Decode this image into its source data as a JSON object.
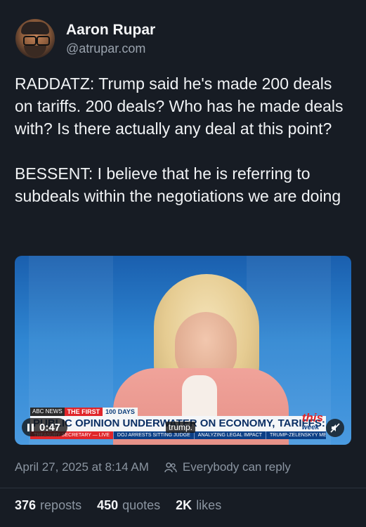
{
  "author": {
    "name": "Aaron Rupar",
    "handle": "@atrupar.com"
  },
  "post": {
    "text": "RADDATZ: Trump said he's made 200 deals on tariffs. 200 deals? Who has he made deals with? Is there actually any deal at this point?\n\nBESSENT: I believe that he is referring to subdeals within the negotiations we are doing"
  },
  "video": {
    "banner_brand": "ABC NEWS",
    "banner_tag": "THE FIRST",
    "banner_tag2": "100 DAYS",
    "headline": "PUBLIC OPINION UNDERWATER ON ECONOMY, TARIFFS: ABC POLL",
    "ticker": [
      "TREASURY SECRETARY — LIVE",
      "DOJ ARRESTS SITTING JUDGE",
      "ANALYZING LEGAL IMPACT",
      "TRUMP-ZELENSKYY MEETING"
    ],
    "logo_top": "this",
    "logo_bottom": "week",
    "time": "0:47",
    "caption": "trump."
  },
  "meta": {
    "timestamp": "April 27, 2025 at 8:14 AM",
    "reply_setting": "Everybody can reply"
  },
  "stats": {
    "reposts_count": "376",
    "reposts_label": "reposts",
    "quotes_count": "450",
    "quotes_label": "quotes",
    "likes_count": "2K",
    "likes_label": "likes"
  }
}
